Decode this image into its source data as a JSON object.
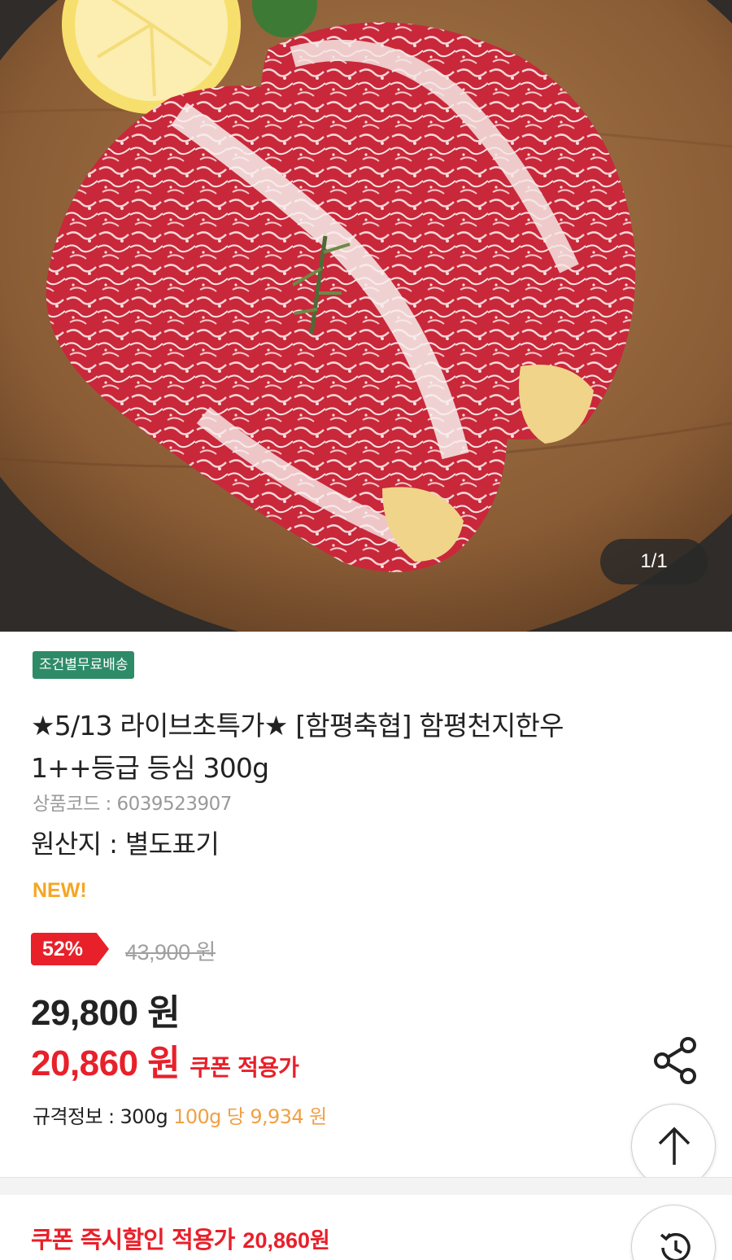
{
  "gallery": {
    "image_icon": "marbled-beef-steak-photo",
    "pager_text": "1/1"
  },
  "product": {
    "shipping_badge": "조건별무료배송",
    "title_line1": "★5/13 라이브초특가★ [함평축협] 함평천지한우",
    "title_line2": "1++등급 등심 300g",
    "code_label": "상품코드 : ",
    "code_value": "6039523907",
    "origin_label": "원산지 : ",
    "origin_value": "별도표기",
    "new_tag": "NEW!"
  },
  "pricing": {
    "discount_rate": "52%",
    "original_price": "43,900 원",
    "sale_price": "29,800 원",
    "coupon_price": "20,860 원",
    "coupon_label": "쿠폰 적용가",
    "spec_label": "규격정보 : ",
    "spec_value": "300g",
    "unit_label": "100g 당",
    "unit_price": "9,934 원"
  },
  "actions": {
    "share_icon": "share-icon",
    "scroll_top_icon": "arrow-up-icon",
    "history_icon": "history-icon"
  },
  "coupon_footer": {
    "label": "쿠폰 즉시할인 적용가",
    "value": "20,860원"
  },
  "colors": {
    "accent_red": "#e8202a",
    "badge_green": "#2e8b68",
    "new_orange": "#f5a623",
    "unit_orange": "#f0a046"
  }
}
